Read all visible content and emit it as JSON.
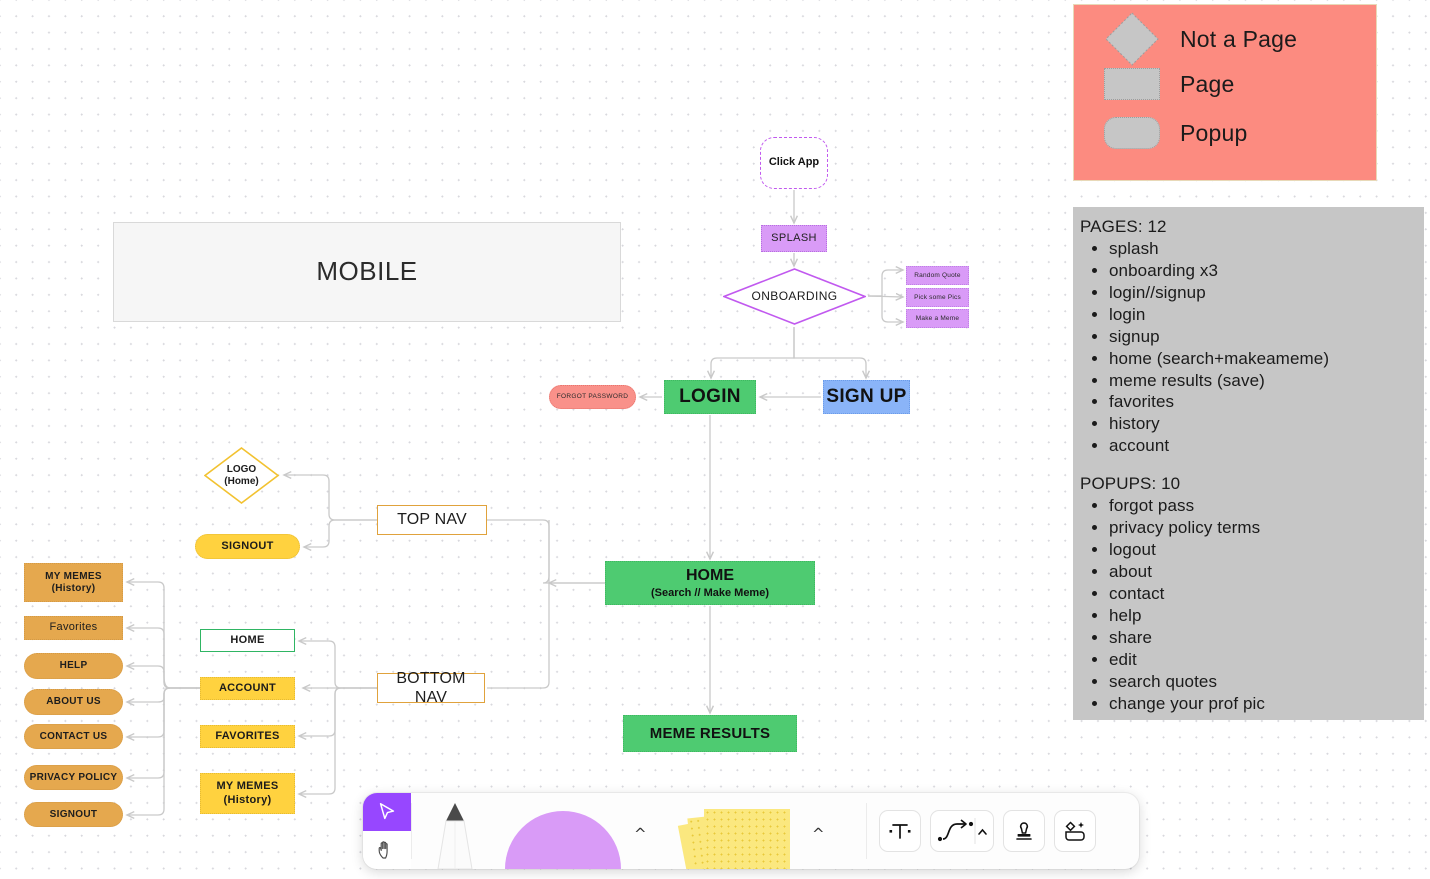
{
  "frame": {
    "title": "MOBILE"
  },
  "flow": {
    "click_app": "Click App",
    "splash": "SPLASH",
    "onboarding": "ONBOARDING",
    "onboarding_steps": [
      "Random Quote",
      "Pick some Pics",
      "Make a Meme"
    ],
    "forgot_password": "FORGOT PASSWORD",
    "login": "LOGIN",
    "signup": "SIGN UP",
    "home_title": "HOME",
    "home_sub": "(Search // Make Meme)",
    "meme_results": "MEME RESULTS"
  },
  "nav": {
    "top_nav": "TOP NAV",
    "bottom_nav": "BOTTOM NAV",
    "logo_line1": "LOGO",
    "logo_line2": "(Home)",
    "signout_top": "SIGNOUT",
    "bottom_items": [
      {
        "label": "HOME"
      },
      {
        "label": "ACCOUNT"
      },
      {
        "label": "FAVORITES"
      },
      {
        "label": "MY MEMES",
        "sub": "(History)"
      }
    ]
  },
  "account_menu": [
    {
      "label": "MY MEMES",
      "sub": "(History)"
    },
    {
      "label": "Favorites"
    },
    {
      "label": "HELP"
    },
    {
      "label": "ABOUT US"
    },
    {
      "label": "CONTACT US"
    },
    {
      "label": "PRIVACY POLICY"
    },
    {
      "label": "SIGNOUT"
    }
  ],
  "legend": {
    "items": [
      {
        "shape": "diamond",
        "label": "Not a Page"
      },
      {
        "shape": "rect",
        "label": "Page"
      },
      {
        "shape": "pill",
        "label": "Popup"
      }
    ],
    "bg": "#fc8b80"
  },
  "notes": {
    "pages_heading": "PAGES: 12",
    "pages": [
      "splash",
      "onboarding x3",
      "login//signup",
      "login",
      "signup",
      "home (search+makeameme)",
      "meme results (save)",
      "favorites",
      "history",
      "account"
    ],
    "popups_heading": "POPUPS: 10",
    "popups": [
      "forgot pass",
      "privacy policy terms",
      "logout",
      "about",
      "contact",
      "help",
      "share",
      "edit",
      "search quotes",
      "change your prof pic"
    ]
  },
  "toolbar": {
    "tools": [
      {
        "name": "cursor-tool",
        "selected": true
      },
      {
        "name": "hand-tool",
        "selected": false
      },
      {
        "name": "pencil-tool",
        "selected": false
      },
      {
        "name": "shape-tool",
        "selected": false
      },
      {
        "name": "sticky-note-tool",
        "selected": false
      },
      {
        "name": "text-tool",
        "selected": false
      },
      {
        "name": "connector-tool",
        "selected": false
      },
      {
        "name": "stamp-tool",
        "selected": false
      },
      {
        "name": "media-tool",
        "selected": false
      }
    ],
    "chevron": "^"
  },
  "colors": {
    "green": "#4ecb71",
    "blue": "#8ab4f8",
    "purple": "#d99bf7",
    "salmon": "#f9918a",
    "yellow": "#ffd23f",
    "orange": "#e5a84e",
    "nav_border": "#e0a23c",
    "legend_bg": "#fc8b80",
    "notes_bg": "#c6c6c6",
    "accent": "#9747ff"
  }
}
